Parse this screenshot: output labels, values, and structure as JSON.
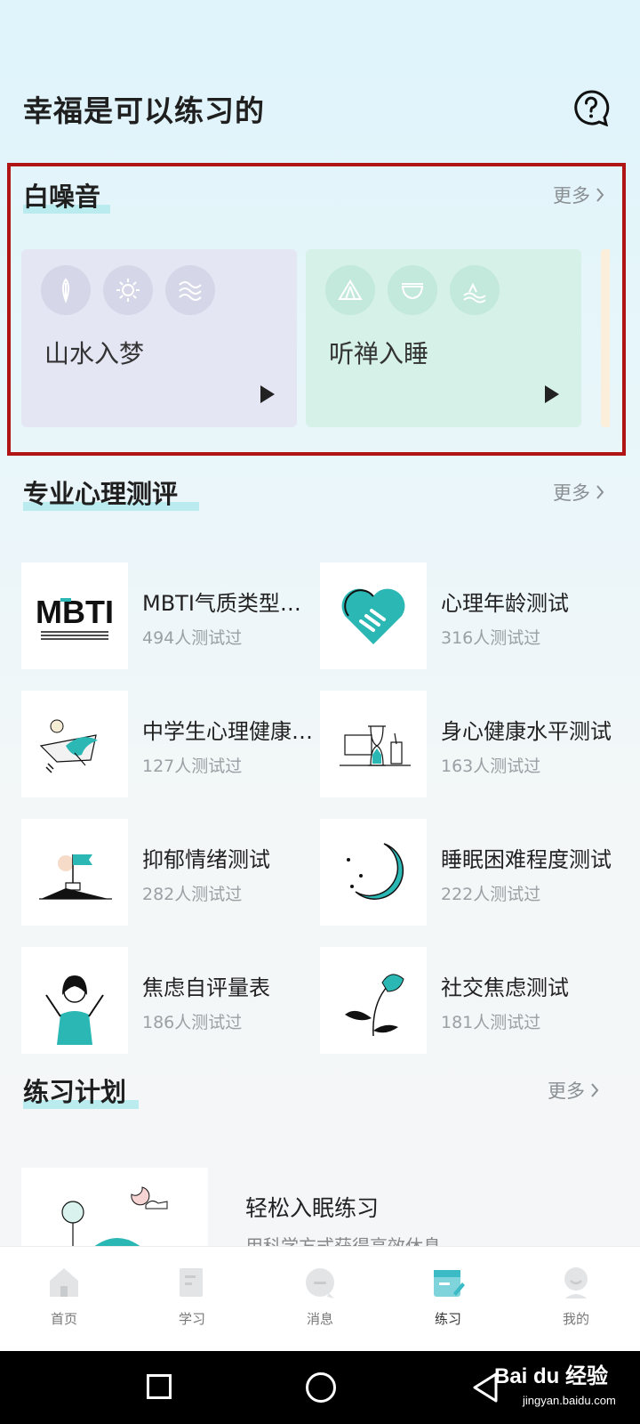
{
  "header": {
    "title": "幸福是可以练习的",
    "help_icon": "question-bubble-icon"
  },
  "white_noise": {
    "title": "白噪音",
    "more": "更多",
    "cards": [
      {
        "label": "山水入梦",
        "bg": "#e4e6f4",
        "icons": [
          "feather-icon",
          "sun-icon",
          "wave-icon"
        ]
      },
      {
        "label": "听禅入睡",
        "bg": "#d6f1e8",
        "icons": [
          "tent-icon",
          "bowl-icon",
          "water-icon"
        ]
      }
    ]
  },
  "tests": {
    "title": "专业心理测评",
    "more": "更多",
    "items": [
      {
        "name": "MBTI气质类型测试",
        "count": "494人测试过",
        "thumb_text": "MBTI"
      },
      {
        "name": "心理年龄测试",
        "count": "316人测试过"
      },
      {
        "name": "中学生心理健康测试",
        "count": "127人测试过"
      },
      {
        "name": "身心健康水平测试",
        "count": "163人测试过"
      },
      {
        "name": "抑郁情绪测试",
        "count": "282人测试过"
      },
      {
        "name": "睡眠困难程度测试",
        "count": "222人测试过"
      },
      {
        "name": "焦虑自评量表",
        "count": "186人测试过"
      },
      {
        "name": "社交焦虑测试",
        "count": "181人测试过"
      }
    ]
  },
  "plan": {
    "title": "练习计划",
    "more": "更多",
    "item_title": "轻松入眠练习",
    "item_sub": "用科学方式获得高效休息"
  },
  "tabbar": [
    {
      "label": "首页",
      "icon": "home-icon"
    },
    {
      "label": "学习",
      "icon": "book-icon"
    },
    {
      "label": "消息",
      "icon": "message-icon"
    },
    {
      "label": "练习",
      "icon": "practice-icon",
      "active": true
    },
    {
      "label": "我的",
      "icon": "profile-icon"
    }
  ],
  "watermark": {
    "logo": "Bai du 经验",
    "url": "jingyan.baidu.com"
  },
  "colors": {
    "accent": "#2bb7b3",
    "highlight_box": "#b01414"
  }
}
